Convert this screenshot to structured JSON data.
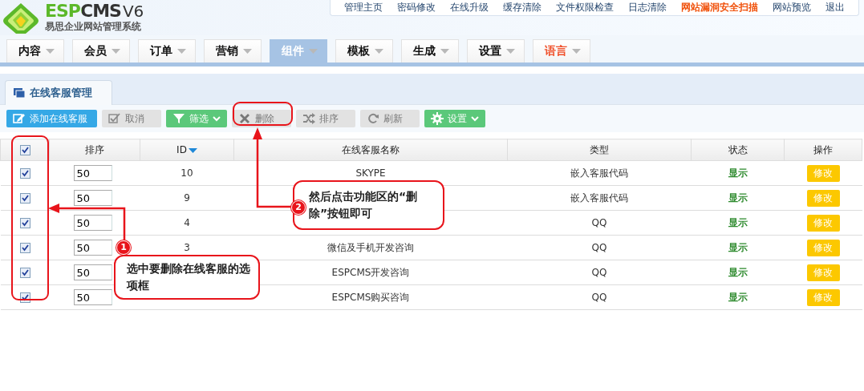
{
  "logo": {
    "brand": "ESPCMS",
    "version": "V6",
    "subtitle": "易思企业网站管理系统"
  },
  "top_links": [
    {
      "label": "管理主页",
      "highlight": false
    },
    {
      "label": "密码修改",
      "highlight": false
    },
    {
      "label": "在线升级",
      "highlight": false
    },
    {
      "label": "缓存清除",
      "highlight": false
    },
    {
      "label": "文件权限检查",
      "highlight": false
    },
    {
      "label": "日志清除",
      "highlight": false
    },
    {
      "label": "网站漏洞安全扫描",
      "highlight": true
    },
    {
      "label": "网站预览",
      "highlight": false
    },
    {
      "label": "退出",
      "highlight": false
    }
  ],
  "nav": [
    {
      "label": "内容",
      "selected": false,
      "highlight": false
    },
    {
      "label": "会员",
      "selected": false,
      "highlight": false
    },
    {
      "label": "订单",
      "selected": false,
      "highlight": false
    },
    {
      "label": "营销",
      "selected": false,
      "highlight": false
    },
    {
      "label": "组件",
      "selected": true,
      "highlight": false
    },
    {
      "label": "模板",
      "selected": false,
      "highlight": false
    },
    {
      "label": "生成",
      "selected": false,
      "highlight": false
    },
    {
      "label": "设置",
      "selected": false,
      "highlight": false
    },
    {
      "label": "语言",
      "selected": false,
      "highlight": true
    }
  ],
  "page_tab": {
    "label": "在线客服管理"
  },
  "toolbar": [
    {
      "label": "添加在线客服",
      "kind": "add",
      "dropdown": false
    },
    {
      "label": "取消",
      "kind": "cancel",
      "dropdown": false
    },
    {
      "label": "筛选",
      "kind": "filter",
      "dropdown": true
    },
    {
      "label": "删除",
      "kind": "delete",
      "dropdown": false
    },
    {
      "label": "排序",
      "kind": "sort",
      "dropdown": false
    },
    {
      "label": "刷新",
      "kind": "refresh",
      "dropdown": false
    },
    {
      "label": "设置",
      "kind": "settings",
      "dropdown": true
    }
  ],
  "table": {
    "header_checked": true,
    "columns": [
      "排序",
      "ID",
      "在线客服名称",
      "类型",
      "状态",
      "操作"
    ],
    "rows": [
      {
        "checked": true,
        "order": "50",
        "id": "10",
        "name": "SKYPE",
        "type": "嵌入客服代码",
        "status": "显示",
        "action": "修改"
      },
      {
        "checked": true,
        "order": "50",
        "id": "9",
        "type": "嵌入客服代码",
        "status": "显示",
        "action": "修改"
      },
      {
        "checked": true,
        "order": "50",
        "id": "4",
        "type": "QQ",
        "status": "显示",
        "action": "修改"
      },
      {
        "checked": true,
        "order": "50",
        "id": "3",
        "name": "微信及手机开发咨询",
        "type": "QQ",
        "status": "显示",
        "action": "修改"
      },
      {
        "checked": true,
        "order": "50",
        "name": "ESPCMS开发咨询",
        "type": "QQ",
        "status": "显示",
        "action": "修改"
      },
      {
        "checked": true,
        "order": "50",
        "name": "ESPCMS购买咨询",
        "type": "QQ",
        "status": "显示",
        "action": "修改"
      }
    ]
  },
  "callouts": [
    {
      "number": "1",
      "text": "选中要删除在线客服的选项框"
    },
    {
      "number": "2",
      "text": "然后点击功能区的“删除”按钮即可"
    }
  ]
}
